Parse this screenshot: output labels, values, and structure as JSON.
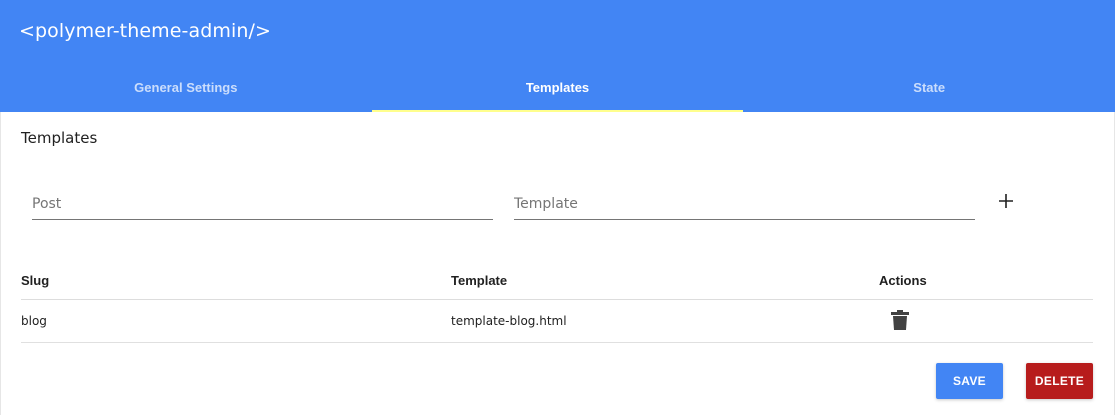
{
  "header": {
    "title": "<polymer-theme-admin/>",
    "background_color": "#4285f4",
    "tabs": [
      {
        "label": "General Settings",
        "active": false
      },
      {
        "label": "Templates",
        "active": true
      },
      {
        "label": "State",
        "active": false
      }
    ],
    "tab_indicator_color": "#ffff8d"
  },
  "section": {
    "title": "Templates"
  },
  "form": {
    "post_placeholder": "Post",
    "post_value": "",
    "template_placeholder": "Template",
    "template_value": "",
    "add_icon": "plus-icon"
  },
  "table": {
    "columns": [
      "Slug",
      "Template",
      "Actions"
    ],
    "rows": [
      {
        "slug": "blog",
        "template": "template-blog.html",
        "action_icon": "trash-icon"
      }
    ]
  },
  "buttons": {
    "save_label": "SAVE",
    "save_color": "#4285f4",
    "delete_label": "DELETE",
    "delete_color": "#b71c1c"
  }
}
